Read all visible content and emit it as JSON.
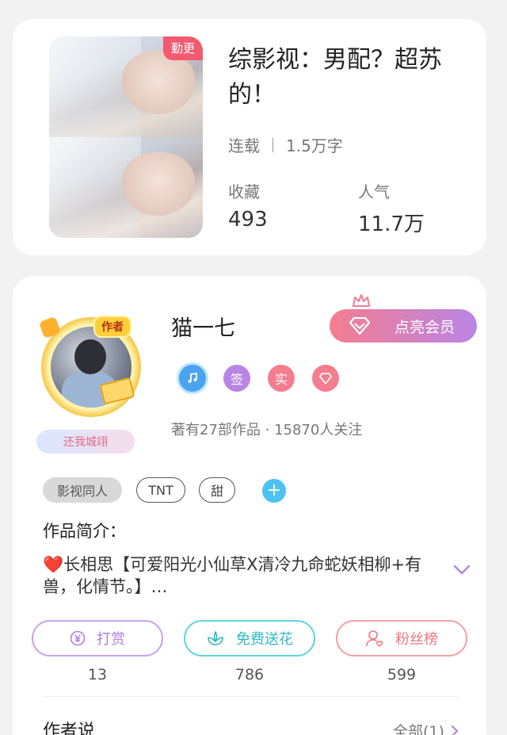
{
  "book": {
    "update_tag": "勤更",
    "title": "综影视：男配？超苏的！",
    "status": "连载",
    "word_count": "1.5万字",
    "stats": [
      {
        "label": "收藏",
        "value": "493"
      },
      {
        "label": "人气",
        "value": "11.7万"
      }
    ]
  },
  "author": {
    "role_badge": "作者",
    "nickname_plate": "还我城翊",
    "name": "猫一七",
    "vip_button": "点亮会员",
    "badges": [
      {
        "icon": "music-note-icon",
        "text": "",
        "color": "#4aa3ef"
      },
      {
        "icon": "sign-icon",
        "text": "签",
        "color": "#b985e4"
      },
      {
        "icon": "verified-icon",
        "text": "实",
        "color": "#f47d8f"
      },
      {
        "icon": "diamond-icon",
        "text": "",
        "color": "#f47d8f"
      }
    ],
    "works_summary": "著有27部作品 · 15870人关注"
  },
  "tags": [
    "影视同人",
    "TNT",
    "甜"
  ],
  "intro": {
    "title": "作品简介：",
    "text": "❤️长相思【可爱阳光小仙草X清冷九命蛇妖相柳+有兽，化情节。】…"
  },
  "actions": [
    {
      "label": "打赏",
      "count": "13",
      "icon": "yen-icon",
      "color": "#b985e4"
    },
    {
      "label": "免费送花",
      "count": "786",
      "icon": "flower-icon",
      "color": "#3fcbd6"
    },
    {
      "label": "粉丝榜",
      "count": "599",
      "icon": "fan-icon",
      "color": "#f07f86"
    }
  ],
  "author_says": {
    "title": "作者说",
    "all_link": "全部(1)"
  }
}
